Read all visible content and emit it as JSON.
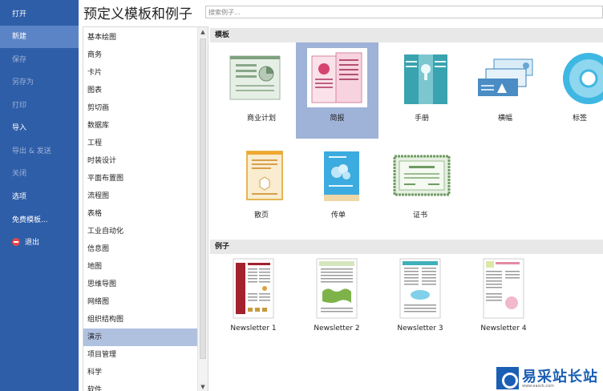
{
  "nav": {
    "items": [
      {
        "label": "打开",
        "state": "normal"
      },
      {
        "label": "新建",
        "state": "selected"
      },
      {
        "label": "保存",
        "state": "disabled"
      },
      {
        "label": "另存为",
        "state": "disabled"
      },
      {
        "label": "打印",
        "state": "disabled"
      },
      {
        "label": "导入",
        "state": "normal"
      },
      {
        "label": "导出 & 发送",
        "state": "disabled"
      },
      {
        "label": "关闭",
        "state": "disabled"
      },
      {
        "label": "选项",
        "state": "normal"
      },
      {
        "label": "免费模板...",
        "state": "normal"
      },
      {
        "label": "退出",
        "state": "normal"
      }
    ]
  },
  "header": {
    "title": "预定义模板和例子",
    "search_placeholder": "搜索例子..."
  },
  "categories": {
    "items": [
      "基本绘图",
      "商务",
      "卡片",
      "图表",
      "剪切画",
      "数据库",
      "工程",
      "时装设计",
      "平面布置图",
      "流程图",
      "表格",
      "工业自动化",
      "信息图",
      "地图",
      "思维导图",
      "网络图",
      "组织结构图",
      "演示",
      "项目管理",
      "科学",
      "软件"
    ],
    "selected": "演示"
  },
  "sections": {
    "templates_label": "模板",
    "examples_label": "例子"
  },
  "templates": [
    {
      "label": "商业计划",
      "icon": "business-plan-icon"
    },
    {
      "label": "简报",
      "icon": "brochure-icon"
    },
    {
      "label": "手册",
      "icon": "manual-icon"
    },
    {
      "label": "横幅",
      "icon": "banner-icon"
    },
    {
      "label": "标签",
      "icon": "cd-label-icon"
    },
    {
      "label": "散页",
      "icon": "flyer-icon"
    },
    {
      "label": "传单",
      "icon": "leaflet-icon"
    },
    {
      "label": "证书",
      "icon": "certificate-icon"
    }
  ],
  "selected_template": "简报",
  "examples": [
    {
      "label": "Newsletter 1"
    },
    {
      "label": "Newsletter 2"
    },
    {
      "label": "Newsletter 3"
    },
    {
      "label": "Newsletter 4"
    }
  ],
  "watermark": {
    "text": "易采站长站",
    "sub": "www.easck.com"
  },
  "colors": {
    "nav_bg": "#2f5ea8",
    "nav_selected": "#5b84c6",
    "list_selected": "#b0c1e0",
    "tile_selected": "#9fb2d8",
    "section_bg": "#e8e8e8"
  }
}
